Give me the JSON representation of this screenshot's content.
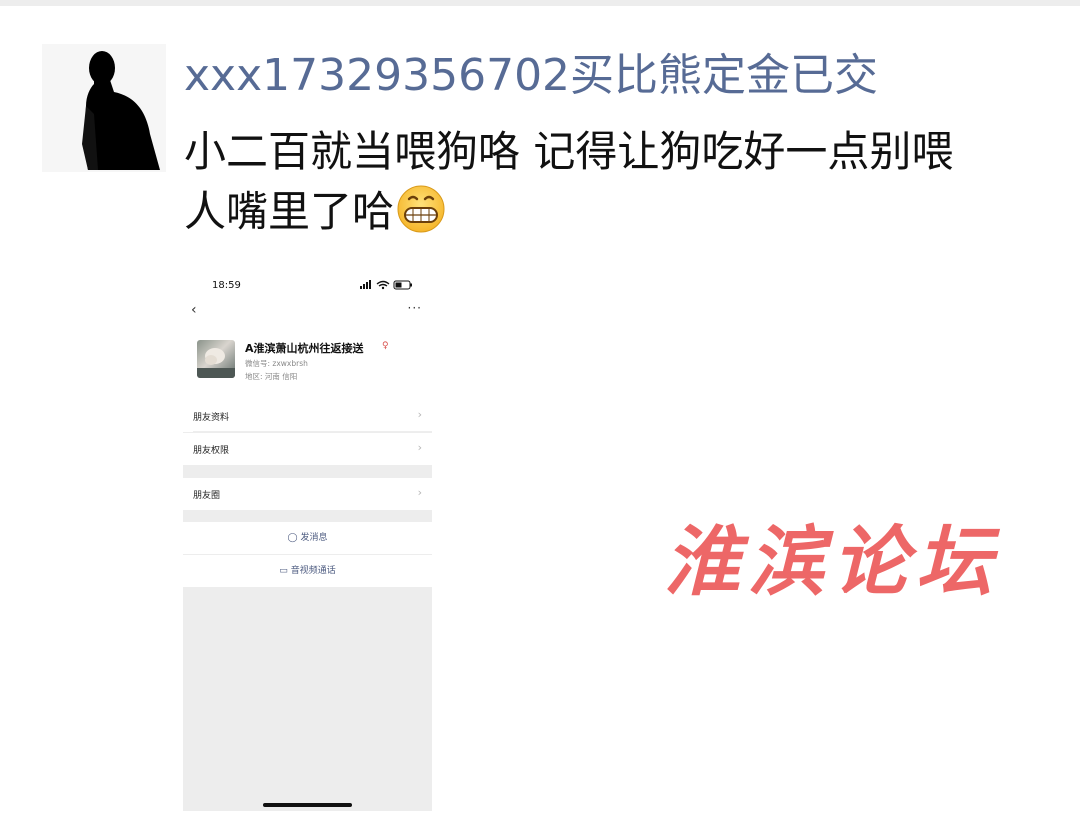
{
  "post": {
    "username": "xxx17329356702买比熊定金已交",
    "message_line1": "小二百就当喂狗咯  记得让狗吃好一点别喂",
    "message_line2": "人嘴里了哈",
    "emoji": "grinning-face-emoji"
  },
  "screenshot": {
    "status_time": "18:59",
    "contact_name": "A淮滨萧山杭州往返接送",
    "wechat_id": "微信号: zxwxbrsh",
    "region": "地区: 河南  信阳",
    "menu": [
      "朋友资料",
      "朋友权限",
      "朋友圈"
    ],
    "actions": [
      {
        "label": "发消息",
        "icon": "chat-bubble-icon"
      },
      {
        "label": "音视频通话",
        "icon": "video-call-icon"
      }
    ]
  },
  "watermark": "淮滨论坛",
  "colors": {
    "username": "#576b95",
    "watermark": "#ec5b5b",
    "background": "#ffffff"
  }
}
